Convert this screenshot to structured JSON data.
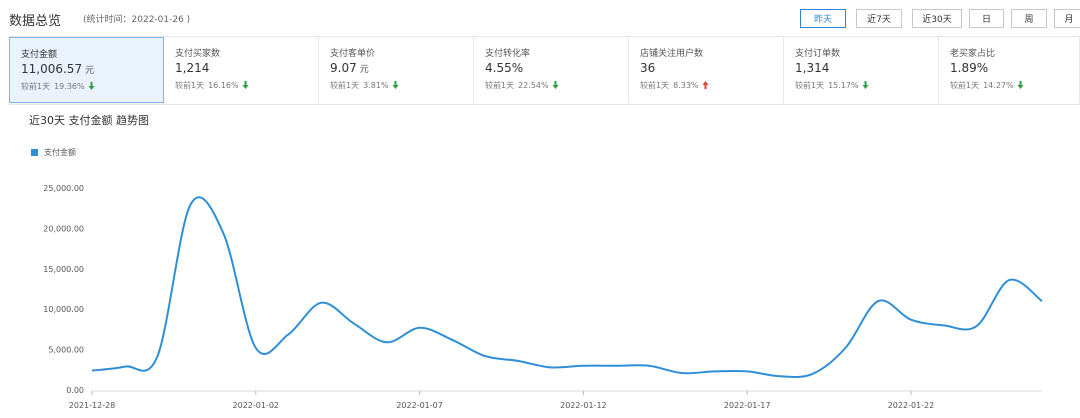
{
  "header": {
    "title": "数据总览",
    "stat_time": "(统计时间：2022-01-26 )",
    "ranges": [
      "昨天",
      "近7天",
      "近30天",
      "日",
      "周",
      "月"
    ],
    "active_range": "昨天"
  },
  "metrics": [
    {
      "label": "支付金额",
      "value": "11,006.57",
      "unit": "元",
      "compare_prefix": "较前1天",
      "compare_pct": "19.36%",
      "trend": "down"
    },
    {
      "label": "支付买家数",
      "value": "1,214",
      "unit": "",
      "compare_prefix": "较前1天",
      "compare_pct": "16.16%",
      "trend": "down"
    },
    {
      "label": "支付客单价",
      "value": "9.07",
      "unit": "元",
      "compare_prefix": "较前1天",
      "compare_pct": "3.81%",
      "trend": "down"
    },
    {
      "label": "支付转化率",
      "value": "4.55%",
      "unit": "",
      "compare_prefix": "较前1天",
      "compare_pct": "22.54%",
      "trend": "down"
    },
    {
      "label": "店铺关注用户数",
      "value": "36",
      "unit": "",
      "compare_prefix": "较前1天",
      "compare_pct": "8.33%",
      "trend": "up"
    },
    {
      "label": "支付订单数",
      "value": "1,314",
      "unit": "",
      "compare_prefix": "较前1天",
      "compare_pct": "15.17%",
      "trend": "down"
    },
    {
      "label": "老买家占比",
      "value": "1.89%",
      "unit": "",
      "compare_prefix": "较前1天",
      "compare_pct": "14.27%",
      "trend": "down"
    }
  ],
  "colors": {
    "accent": "#2f86d6",
    "down": "#2e9e48",
    "up": "#e0413a",
    "series": "#2f8fd6"
  },
  "chart_data": {
    "type": "line",
    "title": "近30天 支付金额 趋势图",
    "legend": [
      "支付金额"
    ],
    "legend_position": "top-left",
    "grid": false,
    "x": [
      "2021-12-28",
      "2021-12-29",
      "2021-12-30",
      "2021-12-31",
      "2022-01-01",
      "2022-01-02",
      "2022-01-03",
      "2022-01-04",
      "2022-01-05",
      "2022-01-06",
      "2022-01-07",
      "2022-01-08",
      "2022-01-09",
      "2022-01-10",
      "2022-01-11",
      "2022-01-12",
      "2022-01-13",
      "2022-01-14",
      "2022-01-15",
      "2022-01-16",
      "2022-01-17",
      "2022-01-18",
      "2022-01-19",
      "2022-01-20",
      "2022-01-21",
      "2022-01-22",
      "2022-01-23",
      "2022-01-24",
      "2022-01-25",
      "2022-01-26"
    ],
    "x_tick_labels": [
      "2021-12-28",
      "2022-01-02",
      "2022-01-07",
      "2022-01-12",
      "2022-01-17",
      "2022-01-22"
    ],
    "series": [
      {
        "name": "支付金额",
        "values": [
          2400,
          2900,
          4200,
          22900,
          19500,
          5200,
          6900,
          10800,
          8200,
          5900,
          7700,
          6200,
          4200,
          3600,
          2800,
          3000,
          3000,
          3000,
          2100,
          2300,
          2300,
          1700,
          2000,
          5200,
          11000,
          8700,
          8000,
          7900,
          13600,
          11000
        ]
      }
    ],
    "ylim": [
      0,
      25000
    ],
    "y_ticks": [
      "0.00",
      "5,000.00",
      "10,000.00",
      "15,000.00",
      "20,000.00",
      "25,000.00"
    ]
  }
}
